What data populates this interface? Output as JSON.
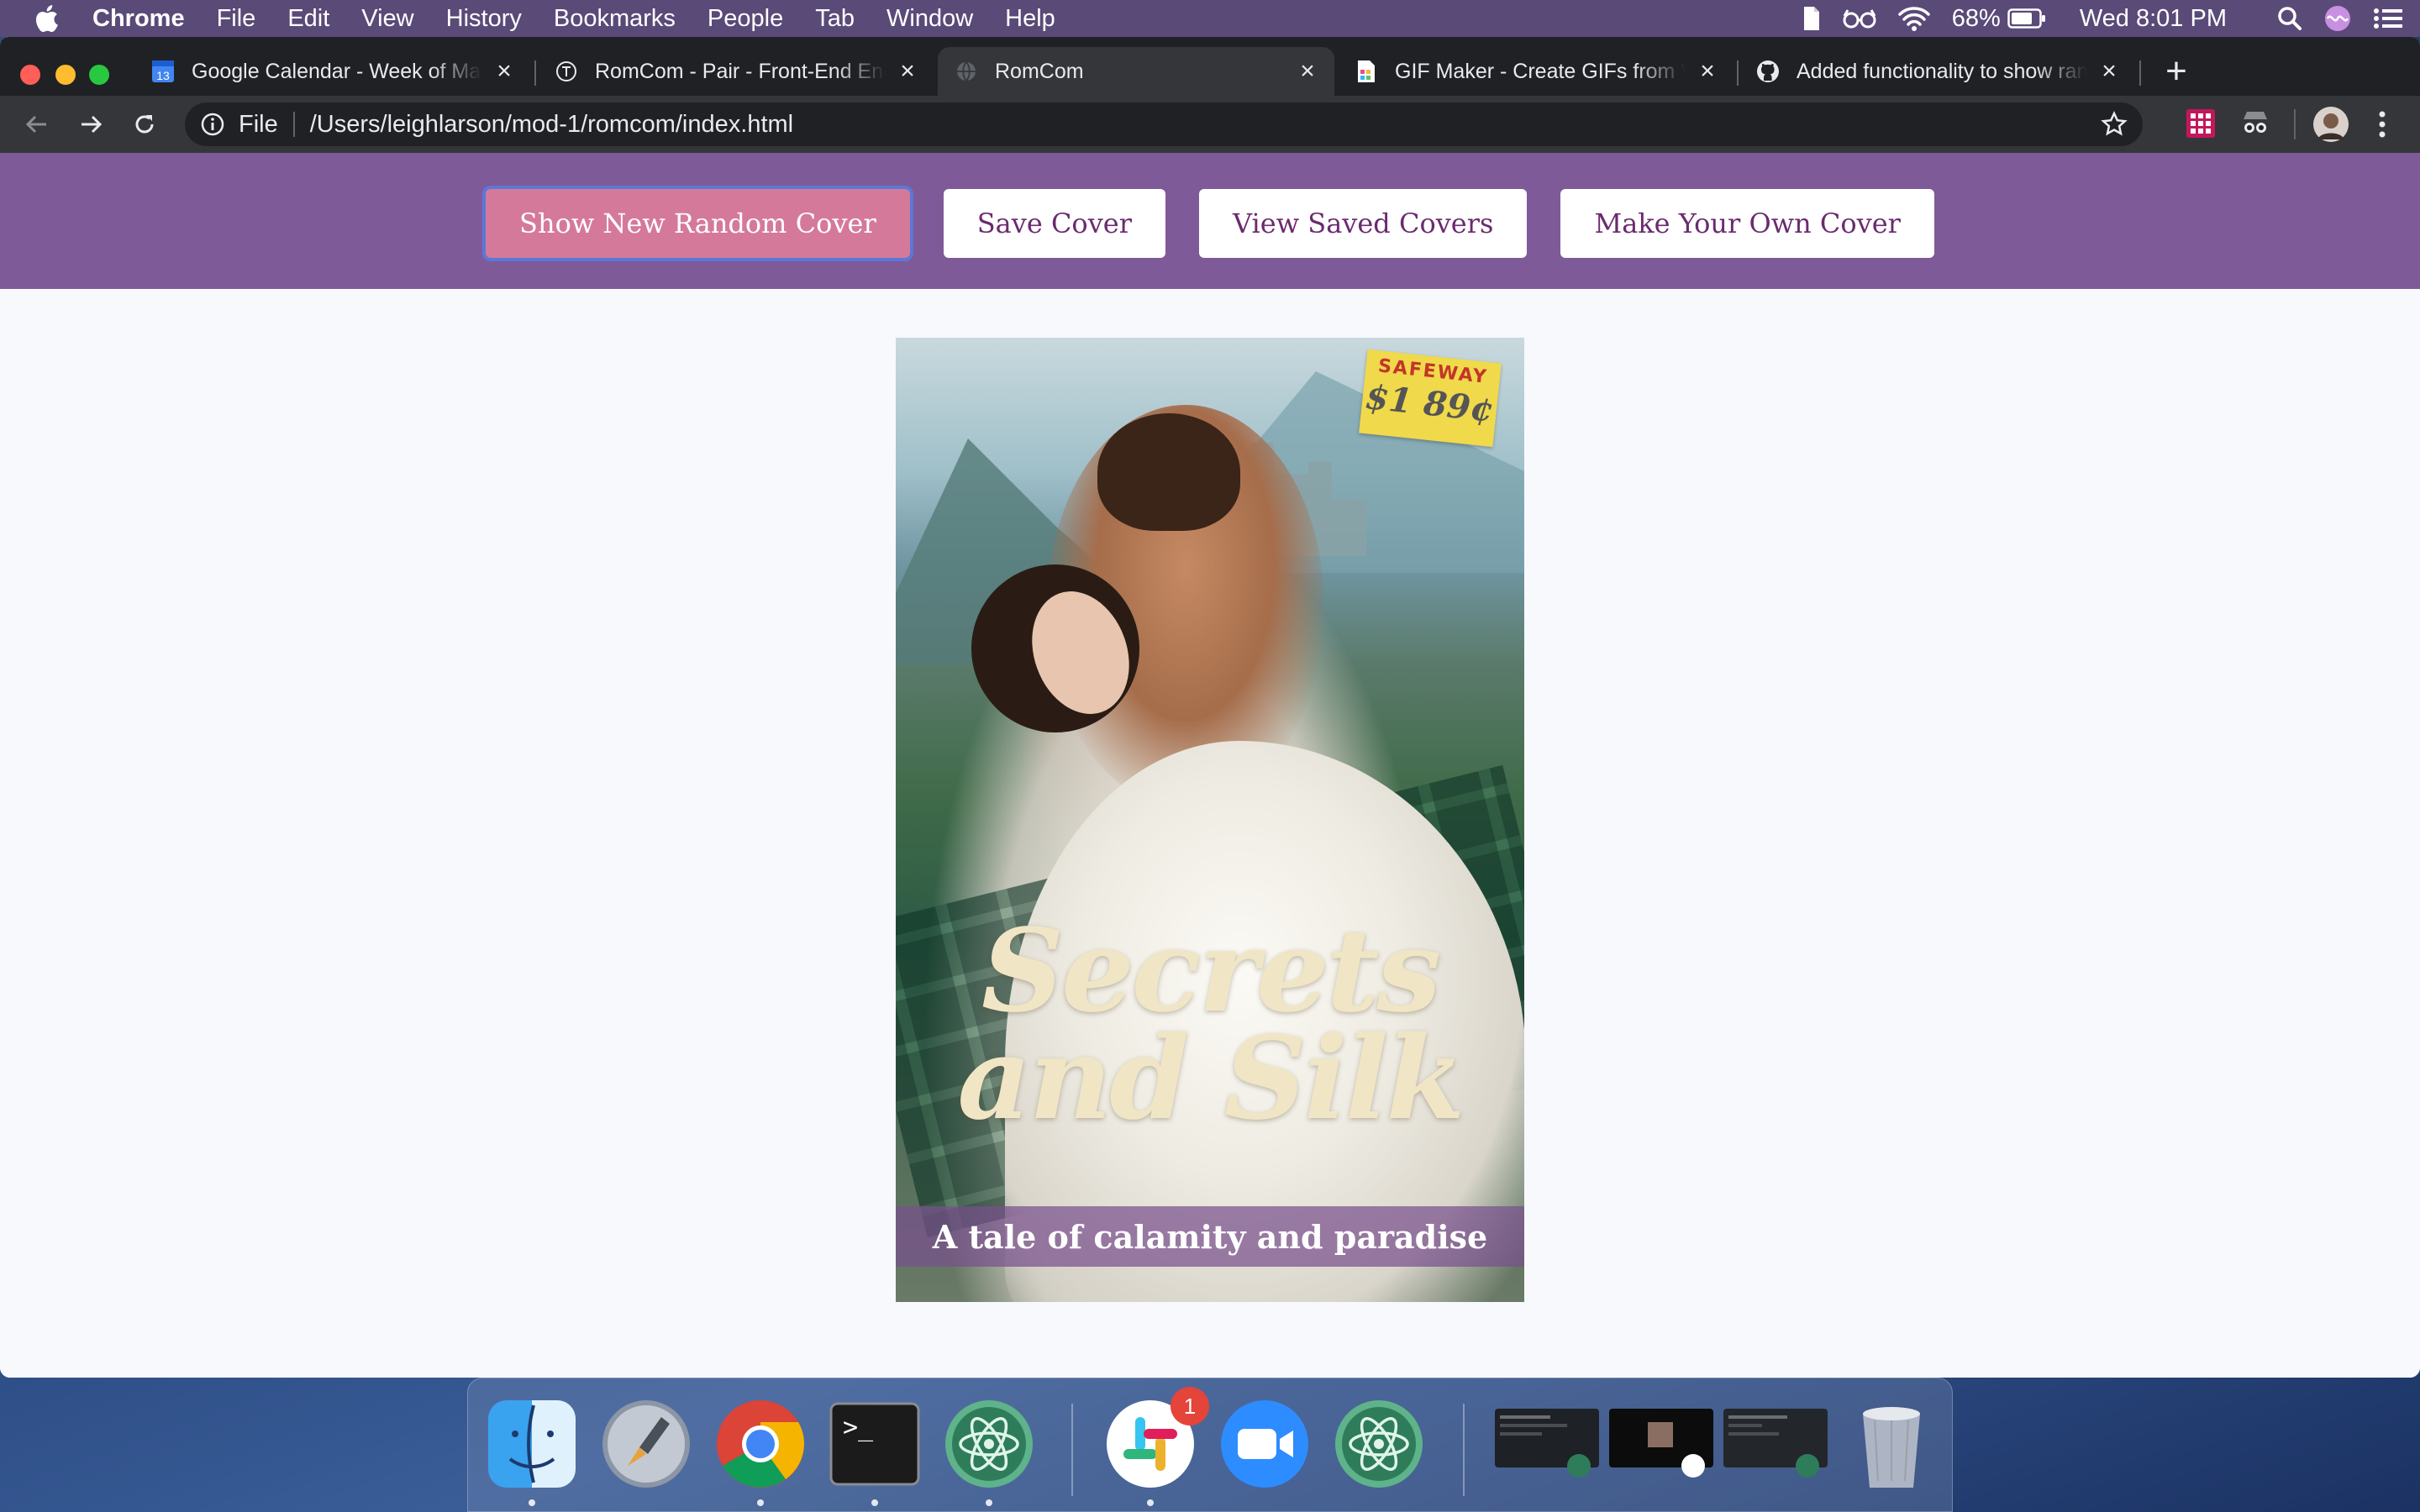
{
  "menubar": {
    "app_name": "Chrome",
    "items": [
      "File",
      "Edit",
      "View",
      "History",
      "Bookmarks",
      "People",
      "Tab",
      "Window",
      "Help"
    ],
    "battery": "68%",
    "clock": "Wed 8:01 PM"
  },
  "browser": {
    "tabs": [
      {
        "title": "Google Calendar - Week of March",
        "icon": "calendar-icon",
        "badge": "13"
      },
      {
        "title": "RomCom - Pair - Front-End Engineering",
        "icon": "turing-icon"
      },
      {
        "title": "RomCom",
        "icon": "globe-icon",
        "active": true
      },
      {
        "title": "GIF Maker - Create GIFs from Video",
        "icon": "document-icon"
      },
      {
        "title": "Added functionality to show random",
        "icon": "github-icon"
      }
    ],
    "address": {
      "scheme": "File",
      "path": "/Users/leighlarson/mod-1/romcom/index.html"
    }
  },
  "page": {
    "buttons": {
      "random": "Show New Random Cover",
      "save": "Save Cover",
      "view_saved": "View Saved Covers",
      "make_own": "Make Your Own Cover"
    },
    "cover": {
      "title": "Secrets and Silk",
      "tagline": "A tale of calamity and paradise",
      "sticker_store": "SAFEWAY",
      "sticker_price": "$1 89¢"
    }
  },
  "dock": {
    "apps": [
      "finder-icon",
      "launchpad-icon",
      "chrome-icon",
      "terminal-icon",
      "atom-icon",
      "slack-icon",
      "zoom-icon",
      "atom-icon",
      "minimized-window",
      "minimized-window",
      "minimized-window",
      "trash-icon"
    ],
    "slack_badge": "1"
  },
  "colors": {
    "header_purple": "#7e5a98",
    "primary_button": "#d5799a",
    "button_text": "#6b2a6f",
    "tagline_bar": "#7a508c"
  }
}
